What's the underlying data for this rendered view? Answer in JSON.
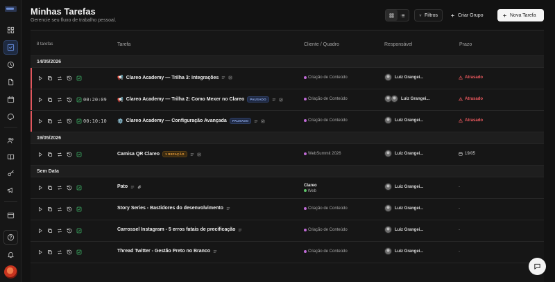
{
  "header": {
    "title": "Minhas Tarefas",
    "subtitle": "Gerencie seu fluxo de trabalho pessoal.",
    "filters_label": "Filtros",
    "create_group_label": "Criar Grupo",
    "new_task_label": "Nova Tarefa"
  },
  "table": {
    "count_label": "8 tarefas",
    "col_task": "Tarefa",
    "col_client": "Cliente / Quadro",
    "col_responsible": "Responsável",
    "col_due": "Prazo"
  },
  "groups": [
    {
      "label": "14/05/2026"
    },
    {
      "label": "19/05/2026"
    },
    {
      "label": "Sem Data"
    }
  ],
  "rows": [
    {
      "timer": "",
      "prefix": "📢",
      "title": "Clareo Academy — Trilha 3: Integrações",
      "badge": "",
      "client": "Criação de Conteúdo",
      "client_color": "#c06ad6",
      "responsible": "Luiz Grangei...",
      "due": "Atrasado"
    },
    {
      "timer": "00:20:09",
      "prefix": "📢",
      "title": "Clareo Academy — Trilha 2: Como Mexer no Clareo",
      "badge": "PAUSADO",
      "client": "Criação de Conteúdo",
      "client_color": "#c06ad6",
      "responsible": "Luiz Grangei...",
      "due": "Atrasado"
    },
    {
      "timer": "00:10:10",
      "prefix": "⚙️",
      "title": "Clareo Academy — Configuração Avançada",
      "badge": "PAUSADO",
      "client": "Criação de Conteúdo",
      "client_color": "#c06ad6",
      "responsible": "Luiz Grangei...",
      "due": "Atrasado"
    },
    {
      "timer": "",
      "prefix": "",
      "title": "Camisa QR Clareo",
      "badge": "1 REFAÇÃO",
      "client": "WebSummit 2026",
      "client_color": "#c06ad6",
      "responsible": "Luiz Grangei...",
      "due": "19/05"
    },
    {
      "timer": "",
      "prefix": "",
      "title": "Pato",
      "badge": "",
      "client_top": "Clareo",
      "client": "Web",
      "client_color": "#5fc46a",
      "responsible": "Luiz Grangei...",
      "due": "-"
    },
    {
      "timer": "",
      "prefix": "",
      "title": "Story Series - Bastidores do desenvolvimento",
      "badge": "",
      "client": "Criação de Conteúdo",
      "client_color": "#c06ad6",
      "responsible": "Luiz Grangei...",
      "due": "-"
    },
    {
      "timer": "",
      "prefix": "",
      "title": "Carrossel Instagram - 5 erros fatais de precificação",
      "badge": "",
      "client": "Criação de Conteúdo",
      "client_color": "#c06ad6",
      "responsible": "Luiz Grangei...",
      "due": "-"
    },
    {
      "timer": "",
      "prefix": "",
      "title": "Thread Twitter - Gestão Preto no Branco",
      "badge": "",
      "client": "Criação de Conteúdo",
      "client_color": "#c06ad6",
      "responsible": "Luiz Grangei...",
      "due": "-"
    }
  ],
  "colors": {
    "late": "#ee5a5f",
    "accent": "#6c93e6",
    "check": "#3fb96a"
  }
}
